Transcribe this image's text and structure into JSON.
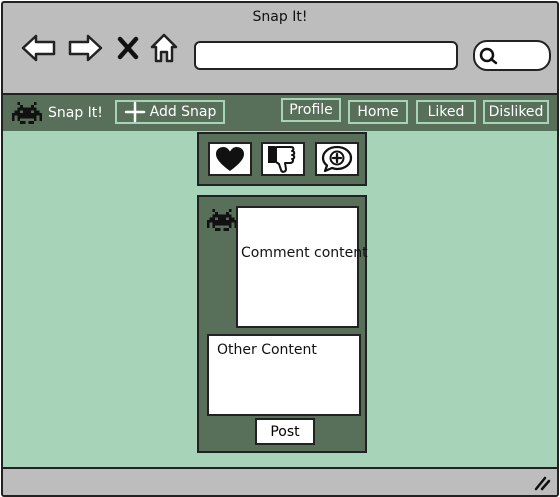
{
  "window": {
    "title": "Snap It!"
  },
  "browser": {
    "url": "",
    "search": ""
  },
  "nav": {
    "brand": "Snap It!",
    "add_snap": "Add Snap",
    "profile": "Profile",
    "home": "Home",
    "liked": "Liked",
    "disliked": "Disliked"
  },
  "post": {
    "comment": "Comment content",
    "other": "Other Content",
    "post_button": "Post"
  },
  "colors": {
    "nav_green": "#58705a",
    "content_mint": "#a7d4b9",
    "chrome_gray": "#bdbdbd"
  },
  "icons": {
    "back": "back-arrow-icon",
    "forward": "forward-arrow-icon",
    "stop": "close-icon",
    "home": "home-icon",
    "search": "search-icon",
    "brand": "space-invader-icon",
    "add": "plus-icon",
    "like": "heart-icon",
    "dislike": "thumbs-down-icon",
    "comment": "comment-plus-icon",
    "avatar": "space-invader-icon",
    "resize": "resize-grip-icon"
  }
}
